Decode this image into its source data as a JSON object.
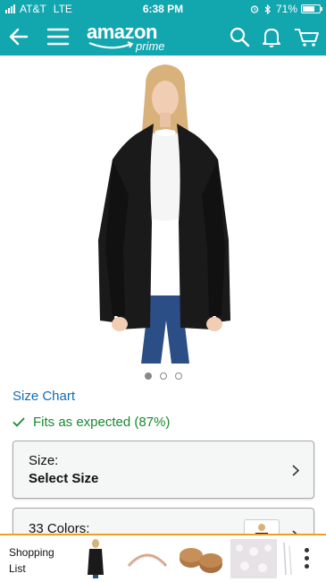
{
  "status_bar": {
    "carrier": "AT&T",
    "network": "LTE",
    "time": "6:38 PM",
    "battery": "71%",
    "battery_level": 0.71
  },
  "nav": {
    "logo_word": "amazon",
    "logo_sub": "prime",
    "back_icon": "back-arrow-icon",
    "menu_icon": "hamburger-menu-icon",
    "search_icon": "search-icon",
    "notification_icon": "bell-icon",
    "cart_icon": "cart-icon"
  },
  "product": {
    "image_alt": "Woman wearing black open-front cardigan",
    "carousel": {
      "count": 3,
      "active_index": 0
    }
  },
  "size_chart_link": "Size Chart",
  "fit": {
    "text": "Fits as expected (87%)"
  },
  "size_option": {
    "label": "Size:",
    "value": "Select Size"
  },
  "colors_option": {
    "label": "33 Colors:"
  },
  "bottom_bar": {
    "shopping_list_label": "Shopping List",
    "more_icon": "vertical-dots-icon"
  },
  "colors": {
    "brand": "#12a6ae",
    "link": "#0f6db5",
    "success": "#178a2f",
    "accent": "#f0a020"
  }
}
